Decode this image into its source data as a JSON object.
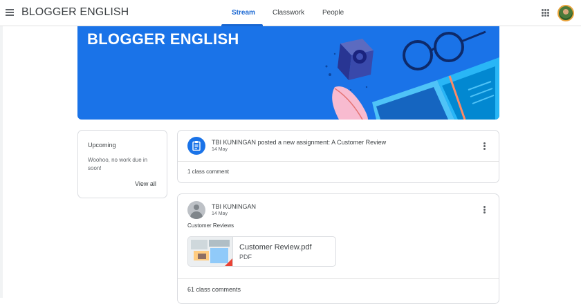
{
  "header": {
    "title": "BLOGGER ENGLISH",
    "tabs": [
      {
        "label": "Stream",
        "active": true
      },
      {
        "label": "Classwork",
        "active": false
      },
      {
        "label": "People",
        "active": false
      }
    ]
  },
  "banner": {
    "title": "BLOGGER ENGLISH",
    "color": "#1a73e8"
  },
  "upcoming": {
    "title": "Upcoming",
    "message": "Woohoo, no work due in soon!",
    "view_all": "View all"
  },
  "posts": [
    {
      "type": "assignment",
      "title": "TBI KUNINGAN posted a new assignment: A Customer Review",
      "date": "14 May",
      "comments": "1 class comment",
      "icon": "assignment-icon"
    },
    {
      "type": "announcement",
      "author": "TBI KUNINGAN",
      "date": "14 May",
      "text": "Customer Reviews",
      "attachment": {
        "name": "Customer Review.pdf",
        "type": "PDF"
      },
      "comments": "61 class comments"
    }
  ],
  "colors": {
    "accent": "#1967d2",
    "text": "#3c4043",
    "muted": "#5f6368",
    "border": "#dadce0"
  }
}
